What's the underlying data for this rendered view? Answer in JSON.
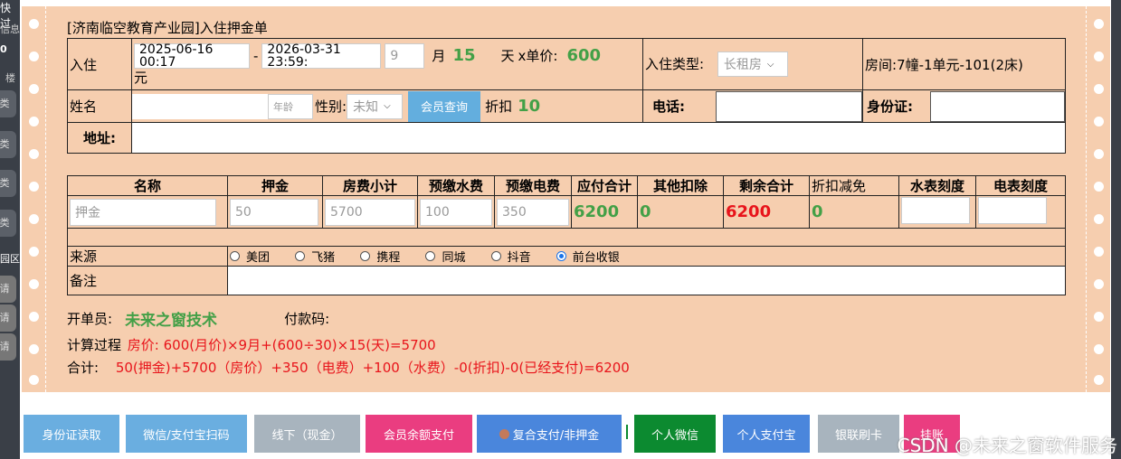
{
  "left_strip": {
    "top": "快过",
    "info": "信息",
    "zero": "0",
    "ch1": "楼",
    "b1": "类",
    "b2": "类",
    "b3": "类",
    "b4": "类",
    "area": "园区",
    "s1": "请",
    "s2": "请",
    "s3": "请"
  },
  "form_title": "[济南临空教育产业园]入住押金单",
  "checkin": {
    "label": "入住",
    "start": "2025-06-16 00:17",
    "dash": "-",
    "end": "2026-03-31 23:59:",
    "months": "9",
    "month_unit": "月",
    "days": "15",
    "day_unit": "天",
    "price_label": "x单价:",
    "price": "600",
    "yuan": "元",
    "type_label": "入住类型:",
    "type_value": "长租房",
    "room_label": "房间:",
    "room_value": "7幢-1单元-101(2床)"
  },
  "guest": {
    "name_label": "姓名",
    "age_placeholder": "年龄",
    "gender_label": "性别:",
    "gender_value": "未知",
    "member_query": "会员查询",
    "discount_label": "折扣",
    "discount_value": "10",
    "phone_label": "电话:",
    "id_label": "身份证:",
    "address_label": "地址:"
  },
  "fees": {
    "headers": [
      "名称",
      "押金",
      "房费小计",
      "预缴水费",
      "预缴电费",
      "应付合计",
      "其他扣除",
      "剩余合计",
      "折扣减免",
      "水表刻度",
      "电表刻度"
    ],
    "name_placeholder": "押金",
    "deposit": "50",
    "room_fee": "5700",
    "water": "100",
    "electric": "350",
    "payable": "6200",
    "other_deduct": "0",
    "remaining": "6200",
    "discount": "0"
  },
  "source": {
    "label": "来源",
    "options": [
      "美团",
      "飞猪",
      "携程",
      "同城",
      "抖音",
      "前台收银"
    ],
    "selected": "前台收银"
  },
  "remark_label": "备注",
  "operator": {
    "label": "开单员:",
    "value": "未来之窗技术",
    "pay_code_label": "付款码:"
  },
  "calc": {
    "label": "计算过程",
    "line1": "房价: 600(月价)×9月+(600÷30)×15(天)=5700",
    "total_label": "合计:",
    "line2": "50(押金)+5700（房价）+350（电费）+100（水费）-0(折扣)-0(已经支付)=6200"
  },
  "buttons": [
    {
      "label": "身份证读取",
      "color": "#6aaee0"
    },
    {
      "label": "微信/支付宝扫码",
      "color": "#6aaee0"
    },
    {
      "label": "线下（现金）",
      "color": "#a8b4be"
    },
    {
      "label": "会员余额支付",
      "color": "#ea3d80"
    },
    {
      "label": "复合支付/非押金",
      "color": "#4a86dc"
    },
    {
      "label": "个人微信",
      "color": "#0c8a30"
    },
    {
      "label": "个人支付宝",
      "color": "#4a86dc"
    },
    {
      "label": "银联刷卡",
      "color": "#a8b4be"
    },
    {
      "label": "挂账",
      "color": "#ea3d80"
    }
  ],
  "watermark": "CSDN @未来之窗软件服务"
}
